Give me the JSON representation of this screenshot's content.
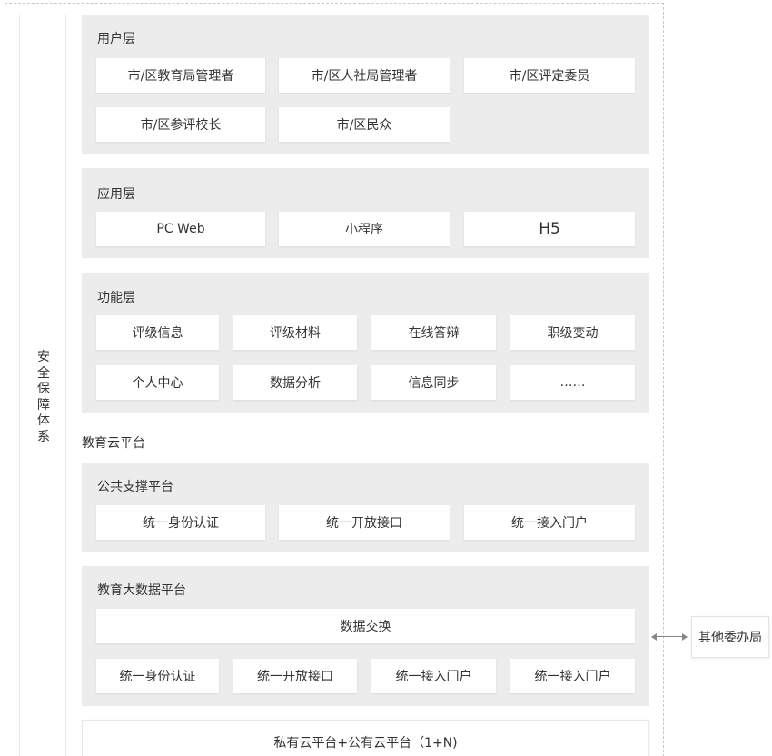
{
  "security": {
    "label": "安\n全\n保\n障\n体\n系"
  },
  "user_layer": {
    "title": "用户层",
    "items": [
      "市/区教育局管理者",
      "市/区人社局管理者",
      "市/区评定委员",
      "市/区参评校长",
      "市/区民众"
    ]
  },
  "app_layer": {
    "title": "应用层",
    "items": [
      "PC Web",
      "小程序",
      "H5"
    ]
  },
  "func_layer": {
    "title": "功能层",
    "items": [
      "评级信息",
      "评级材料",
      "在线答辩",
      "职级变动",
      "个人中心",
      "数据分析",
      "信息同步",
      "……"
    ]
  },
  "cloud_platform": {
    "label": "教育云平台"
  },
  "public_support": {
    "title": "公共支撑平台",
    "items": [
      "统一身份认证",
      "统一开放接口",
      "统一接入门户"
    ]
  },
  "big_data": {
    "title": "教育大数据平台",
    "exchange": "数据交换",
    "items": [
      "统一身份认证",
      "统一开放接口",
      "统一接入门户",
      "统一接入门户"
    ]
  },
  "bottom": {
    "label": "私有云平台+公有云平台（1+N)"
  },
  "external": {
    "label": "其他委办局"
  }
}
